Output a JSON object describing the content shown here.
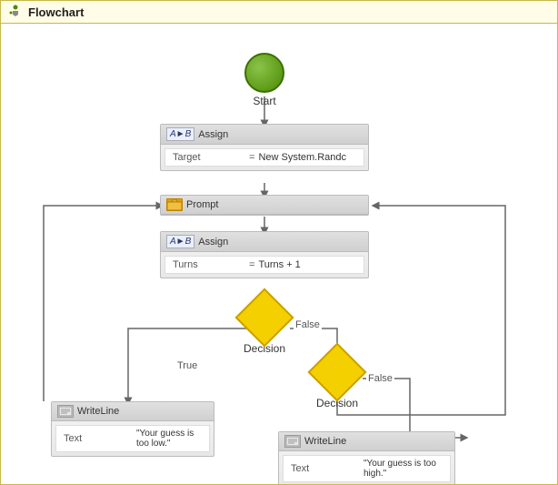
{
  "window": {
    "title": "Flowchart"
  },
  "nodes": {
    "start": {
      "label": "Start"
    },
    "assign1": {
      "header": "Assign",
      "row_key": "Target",
      "row_eq": "=",
      "row_val": "New System.Randc"
    },
    "prompt": {
      "label": "Prompt"
    },
    "assign2": {
      "header": "Assign",
      "row_key": "Turns",
      "row_eq": "=",
      "row_val": "Turns + 1"
    },
    "decision1": {
      "label": "Decision"
    },
    "decision2": {
      "label": "Decision"
    },
    "writeline1": {
      "header": "WriteLine",
      "row_key": "Text",
      "row_val": "\"Your guess is too low.\""
    },
    "writeline2": {
      "header": "WriteLine",
      "row_key": "Text",
      "row_val": "\"Your guess is too high.\""
    }
  },
  "labels": {
    "true": "True",
    "false1": "False",
    "false2": "False"
  },
  "icons": {
    "title": "flowchart-icon",
    "ab": "A►B",
    "prompt": "📂",
    "writeline": "✎"
  },
  "colors": {
    "start_green": "#4a8a00",
    "diamond_yellow": "#f5d000",
    "window_border": "#c8b84a",
    "window_bg": "#fffde7"
  }
}
